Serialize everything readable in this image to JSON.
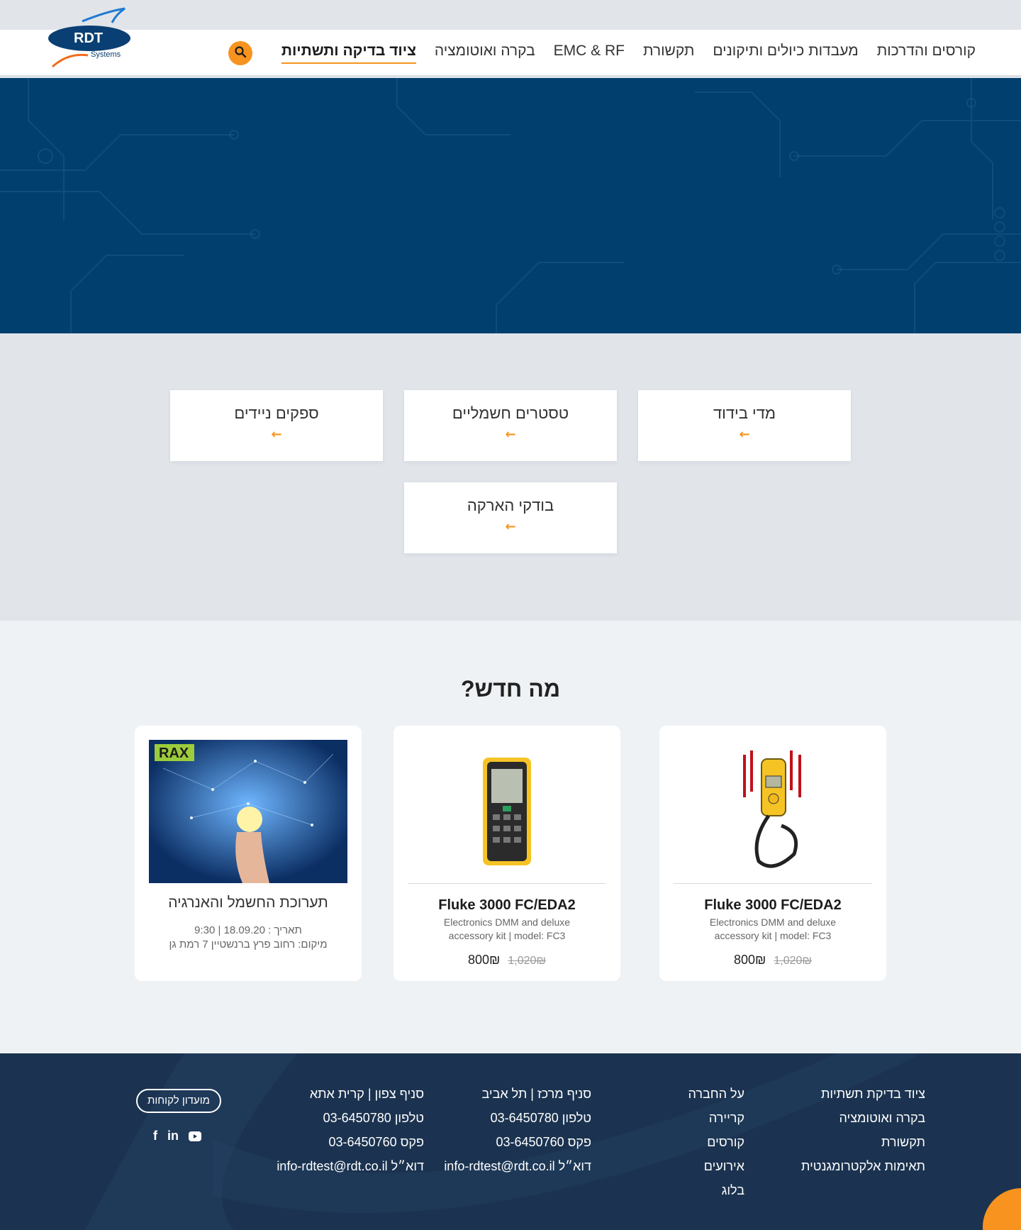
{
  "header": {
    "logo_text": "RDT",
    "logo_sub": "Systems",
    "nav": [
      {
        "label": "ציוד בדיקה ותשתיות"
      },
      {
        "label": "בקרה ואוטומציה"
      },
      {
        "label": "EMC & RF"
      },
      {
        "label": "תקשורת"
      },
      {
        "label": "מעבדות כיולים ותיקונים"
      },
      {
        "label": "קורסים והדרכות"
      }
    ]
  },
  "categories": [
    {
      "label": "מדי בידוד",
      "arrow": "←"
    },
    {
      "label": "טסטרים חשמליים",
      "arrow": "←"
    },
    {
      "label": "ספקים ניידים",
      "arrow": "←"
    },
    {
      "label": "בודקי הארקה",
      "arrow": "←"
    }
  ],
  "news": {
    "heading": "מה חדש?",
    "products": [
      {
        "title": "Fluke 3000 FC/EDA2",
        "desc": "Electronics DMM and deluxe accessory kit | model: FC3",
        "price": "800₪",
        "old_price": "1,020₪"
      },
      {
        "title": "Fluke 3000 FC/EDA2",
        "desc": "Electronics DMM and deluxe accessory kit | model: FC3",
        "price": "800₪",
        "old_price": "1,020₪"
      }
    ],
    "event": {
      "badge": "RAX",
      "title": "תערוכת החשמל והאנרגיה",
      "date": "תאריך : 18.09.20 | 9:30",
      "location": "מיקום: רחוב פרץ ברנשטיין 7 רמת גן"
    }
  },
  "footer": {
    "col1": [
      "ציוד בדיקת תשתיות",
      "בקרה ואוטומציה",
      "תקשורת",
      "תאימות אלקטרומגנטית"
    ],
    "col2": [
      "על החברה",
      "קריירה",
      "קורסים",
      "אירועים",
      "בלוג"
    ],
    "col3": [
      "סניף מרכז | תל אביב",
      "טלפון 03-6450780",
      "פקס 03-6450760",
      "דוא״ל info-rdtest@rdt.co.il"
    ],
    "col4": [
      "סניף צפון | קרית אתא",
      "טלפון 03-6450780",
      "פקס 03-6450760",
      "דוא״ל info-rdtest@rdt.co.il"
    ],
    "club_button": "מועדון לקוחות",
    "social": {
      "facebook": "f",
      "linkedin": "in"
    }
  },
  "colors": {
    "accent": "#f7931e",
    "hero": "#003f6e",
    "footer": "#1b3350"
  }
}
